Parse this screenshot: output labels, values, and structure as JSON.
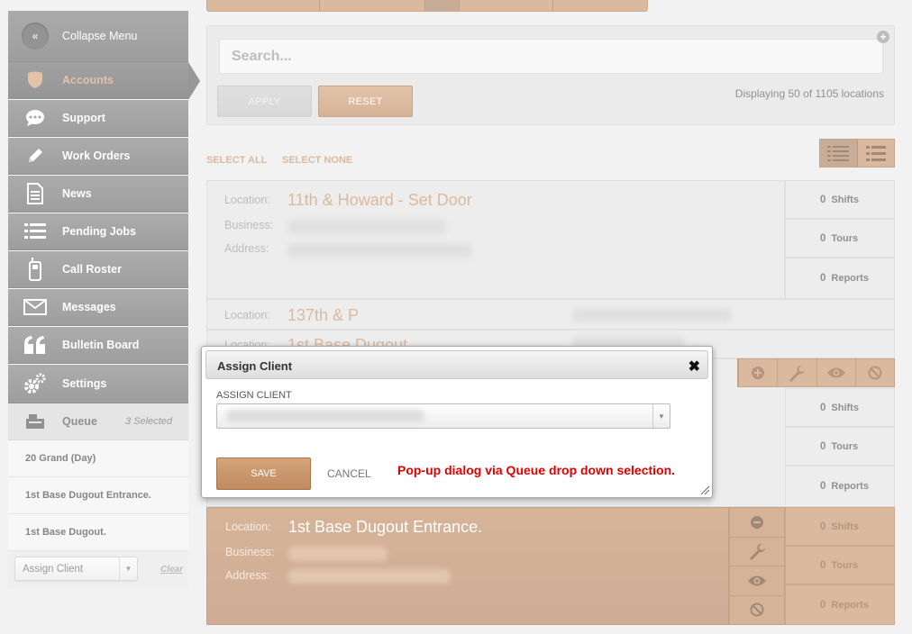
{
  "colors": {
    "accent": "#c8946a",
    "annotation": "#e00000",
    "nav_bg": "#737373"
  },
  "sidebar": {
    "collapse_label": "Collapse Menu",
    "items": [
      {
        "label": "Accounts",
        "icon": "shield-icon"
      },
      {
        "label": "Support",
        "icon": "chat-bubble-icon"
      },
      {
        "label": "Work Orders",
        "icon": "pencil-icon"
      },
      {
        "label": "News",
        "icon": "document-icon"
      },
      {
        "label": "Pending Jobs",
        "icon": "list-icon"
      },
      {
        "label": "Call Roster",
        "icon": "phone-icon"
      },
      {
        "label": "Messages",
        "icon": "envelope-icon"
      },
      {
        "label": "Bulletin Board",
        "icon": "quote-icon"
      },
      {
        "label": "Settings",
        "icon": "gear-icon"
      }
    ],
    "queue": {
      "title": "Queue",
      "count": "3 Selected",
      "items": [
        "20 Grand (Day)",
        "1st Base Dugout Entrance.",
        "1st Base Dugout."
      ],
      "assign_select": "Assign Client",
      "clear": "Clear"
    }
  },
  "search": {
    "placeholder": "Search...",
    "apply": "APPLY",
    "reset": "RESET",
    "displaying": "Displaying 50 of 1105 locations"
  },
  "selection": {
    "select_all": "SELECT ALL",
    "select_none": "SELECT NONE"
  },
  "labels": {
    "location": "Location:",
    "business": "Business:",
    "address": "Address:"
  },
  "locations": [
    {
      "name": "11th & Howard - Set Door",
      "shifts": "0",
      "tours": "0",
      "reports": "0"
    },
    {
      "name": "137th & P"
    },
    {
      "name": "1st Base Dugout"
    },
    {
      "name": "1st Base Dugout Entrance.",
      "shifts": "0",
      "tours": "0",
      "reports": "0"
    }
  ],
  "stats_labels": {
    "shifts": "Shifts",
    "tours": "Tours",
    "reports": "Reports"
  },
  "stats_mid": {
    "shifts": "0",
    "tours": "0",
    "reports": "0"
  },
  "modal": {
    "title": "Assign Client",
    "field_label": "ASSIGN CLIENT",
    "save": "SAVE",
    "cancel": "CANCEL",
    "annotation": "Pop-up dialog via Queue drop down selection."
  }
}
